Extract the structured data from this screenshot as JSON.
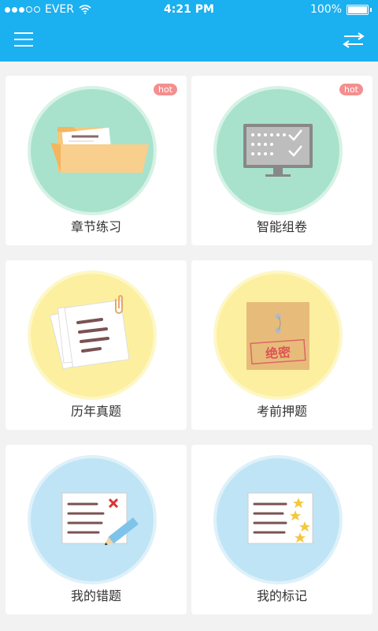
{
  "status": {
    "carrier": "EVER",
    "time": "4:21 PM",
    "battery": "100%",
    "signal_bars_filled": 3,
    "signal_bars_total": 5
  },
  "cards": [
    {
      "label": "章节练习",
      "badge": "hot"
    },
    {
      "label": "智能组卷",
      "badge": "hot"
    },
    {
      "label": "历年真题"
    },
    {
      "label": "考前押题",
      "stamp_text": "绝密"
    },
    {
      "label": "我的错题"
    },
    {
      "label": "我的标记"
    }
  ],
  "colors": {
    "accent": "#1bb0f0",
    "hot_badge": "#f48f8f",
    "green_circle": "#a8e2cc",
    "yellow_circle": "#fcf0a0",
    "blue_circle": "#bfe4f5"
  }
}
